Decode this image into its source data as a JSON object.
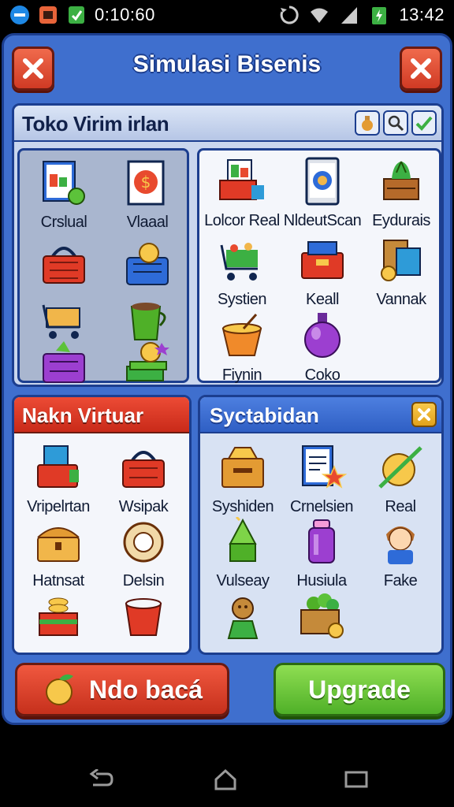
{
  "status_bar": {
    "time_left": "0:10:60",
    "time_right": "13:42",
    "icons": [
      "minus-circle-icon",
      "app-notification-icon",
      "battery-saver-icon",
      "sync-icon",
      "wifi-icon",
      "signal-icon",
      "battery-icon"
    ]
  },
  "header": {
    "title": "Simulasi Bisenis"
  },
  "panel_top": {
    "title": "Toko Virim irlan",
    "tools": [
      "potion-icon",
      "magnifier-icon",
      "checkmark-icon"
    ],
    "left_items": [
      {
        "label": "Crslual",
        "icon": "book-gear-icon"
      },
      {
        "label": "Vlaaal",
        "icon": "dollar-card-icon"
      },
      {
        "label": "",
        "icon": "red-basket-icon"
      },
      {
        "label": "",
        "icon": "coin-basket-icon"
      },
      {
        "label": "",
        "icon": "shopping-cart-icon"
      },
      {
        "label": "",
        "icon": "green-cup-icon"
      },
      {
        "label": "",
        "icon": "purple-basket-icon"
      },
      {
        "label": "",
        "icon": "cash-coins-icon"
      }
    ],
    "right_items": [
      {
        "label": "Lolcor Real",
        "icon": "store-screen-icon"
      },
      {
        "label": "NldeutScan",
        "icon": "tablet-icon"
      },
      {
        "label": "Eydurais",
        "icon": "plant-stand-icon"
      },
      {
        "label": "Systien",
        "icon": "grocery-cart-icon"
      },
      {
        "label": "Keall",
        "icon": "red-box-icon"
      },
      {
        "label": "Vannak",
        "icon": "price-box-gear-icon"
      },
      {
        "label": "Fiynin",
        "icon": "bowl-icon"
      },
      {
        "label": "Coko",
        "icon": "purple-potion-icon"
      }
    ]
  },
  "panel_bottom_left": {
    "title": "Nakn Virtuar",
    "items": [
      {
        "label": "Vripelrtan",
        "icon": "books-basket-icon"
      },
      {
        "label": "Wsipak",
        "icon": "red-basket-icon"
      },
      {
        "label": "Hatnsat",
        "icon": "treasure-chest-icon"
      },
      {
        "label": "Delsin",
        "icon": "tape-roll-icon"
      },
      {
        "label": "",
        "icon": "coin-box-icon"
      },
      {
        "label": "",
        "icon": "red-bucket-icon"
      }
    ]
  },
  "panel_bottom_right": {
    "title": "Syctabidan",
    "close_icon": "close-icon",
    "items": [
      {
        "label": "Syshiden",
        "icon": "open-chest-icon"
      },
      {
        "label": "Crnelsien",
        "icon": "notebook-star-icon"
      },
      {
        "label": "Real",
        "icon": "golden-orb-icon"
      },
      {
        "label": "Vulseay",
        "icon": "green-cone-icon"
      },
      {
        "label": "Husiula",
        "icon": "purple-bottle-icon"
      },
      {
        "label": "Fake",
        "icon": "boy-avatar-icon"
      },
      {
        "label": "",
        "icon": "shopkeeper-icon"
      },
      {
        "label": "",
        "icon": "vegetable-box-icon"
      }
    ]
  },
  "buttons": {
    "left_label": "Ndo bacá",
    "right_label": "Upgrade"
  },
  "colors": {
    "frame_blue": "#3f6fce",
    "close_red": "#d03a24",
    "upgrade_green": "#4fb028",
    "gold": "#e2a21c"
  }
}
